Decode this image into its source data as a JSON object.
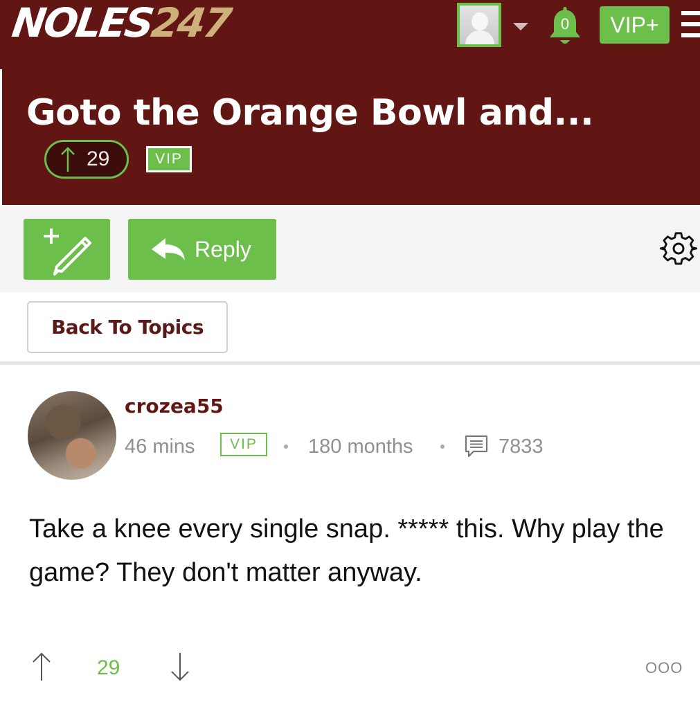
{
  "header": {
    "logo_part1": "NOLES",
    "logo_part2": "247",
    "notification_count": "0",
    "vip_plus_label": "VIP+",
    "thread_title": "Goto the Orange Bowl and...",
    "thread_votes": "29",
    "thread_badge": "VIP"
  },
  "toolbar": {
    "new_post_icon": "pencil-plus-icon",
    "reply_label": "Reply",
    "settings_icon": "gear-icon"
  },
  "navigation": {
    "back_label": "Back To Topics"
  },
  "post": {
    "username": "crozea55",
    "time_ago": "46 mins",
    "badge": "VIP",
    "membership": "180 months",
    "post_count": "7833",
    "body": "Take a knee every single snap. ***** this. Why play the game? They don't matter anyway.",
    "votes": "29",
    "more_label": "OOO"
  },
  "colors": {
    "brand_maroon": "#621614",
    "accent_green": "#6cbf4a",
    "logo_gold": "#cdb07a"
  }
}
